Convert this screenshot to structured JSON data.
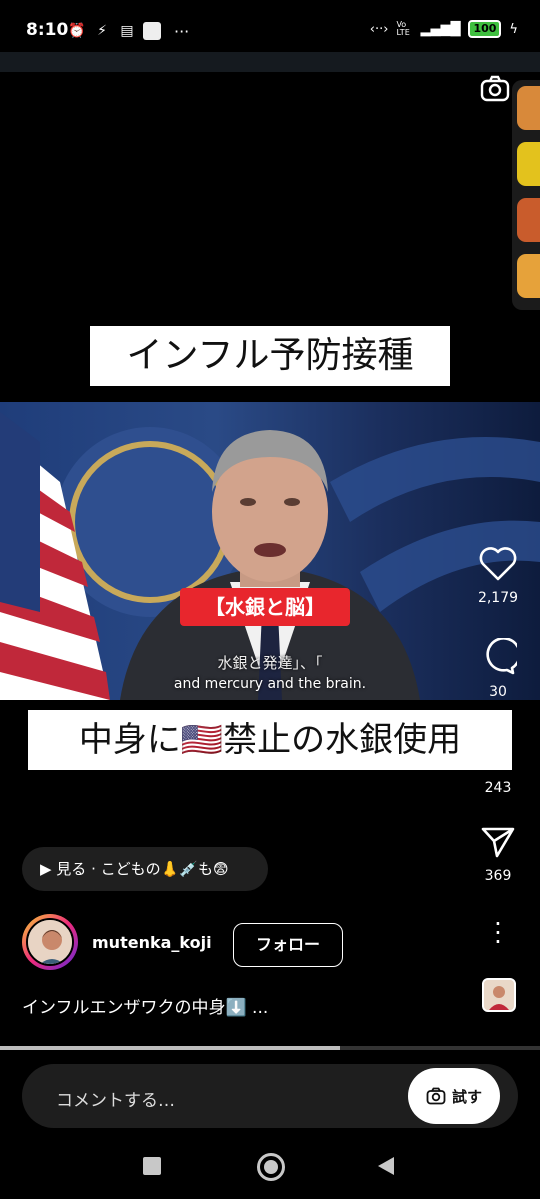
{
  "status_bar": {
    "time": "8:10",
    "more": "···",
    "volte": "Vo LTE",
    "battery": "100"
  },
  "reel": {
    "title_top": "インフル予防接種",
    "video_tag": "【水銀と脳】",
    "subtitle_jp": "水銀と発達」、「",
    "subtitle_en": "and mercury and the brain.",
    "title_bottom": "中身に🇺🇸禁止の水銀使用"
  },
  "actions": {
    "likes": "2,179",
    "comments": "30",
    "reposts": "243",
    "shares": "369"
  },
  "audio_chip": "▶ 見る · こどもの👃💉も😨",
  "author": {
    "username": "mutenka_koji",
    "follow_label": "フォロー"
  },
  "caption": "インフルエンザワクの中身⬇️ ...",
  "progress": 0.63,
  "comment": {
    "placeholder": "コメントする…",
    "try_label": "試す"
  }
}
